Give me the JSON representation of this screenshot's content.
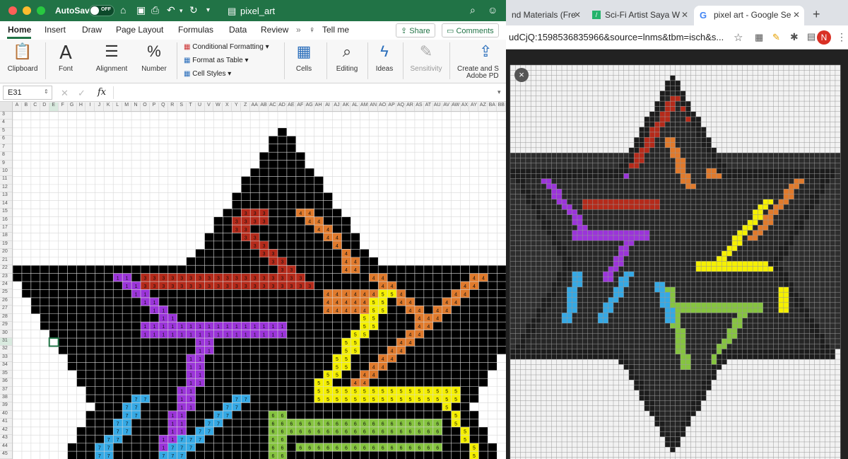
{
  "excel": {
    "window_controls": {
      "close_color": "#ff5f57",
      "min_color": "#febc2e",
      "max_color": "#28c840"
    },
    "autosave_label": "AutoSave",
    "autosave_state": "OFF",
    "doc_title": "pixel_art",
    "ribbon_tabs": [
      "Home",
      "Insert",
      "Draw",
      "Page Layout",
      "Formulas",
      "Data",
      "Review"
    ],
    "overflow": "»",
    "tell_me": "Tell me",
    "share_label": "Share",
    "comments_label": "Comments",
    "groups": {
      "clipboard": "Clipboard",
      "font": "Font",
      "alignment": "Alignment",
      "number": "Number",
      "conditional_formatting": "Conditional Formatting",
      "format_as_table": "Format as Table",
      "cell_styles": "Cell Styles",
      "cells": "Cells",
      "editing": "Editing",
      "ideas": "Ideas",
      "sensitivity": "Sensitivity",
      "create_share": "Create and S",
      "adobe": "Adobe PD"
    },
    "name_box": "E31",
    "fx_label": "fx",
    "columns": [
      "A",
      "B",
      "C",
      "D",
      "E",
      "F",
      "G",
      "H",
      "I",
      "J",
      "K",
      "L",
      "M",
      "N",
      "O",
      "P",
      "Q",
      "R",
      "S",
      "T",
      "U",
      "V",
      "W",
      "X",
      "Y",
      "Z",
      "AA",
      "AB",
      "AC",
      "AD",
      "AE",
      "AF",
      "AG",
      "AH",
      "AI",
      "AJ",
      "AK",
      "AL",
      "AM",
      "AN",
      "AO",
      "AP",
      "AQ",
      "AR",
      "AS",
      "AT",
      "AU",
      "AV",
      "AW",
      "AX",
      "AY",
      "AZ",
      "BA",
      "BB"
    ],
    "first_row": 3,
    "last_row": 45,
    "selected_cell": "E31",
    "colors": {
      "accent": "#217346",
      "black": "#000000",
      "color_1": "#9b34d9",
      "color_3": "#b52a1a",
      "color_4": "#e07a2c",
      "color_5": "#f5f000",
      "color_6": "#86c440",
      "color_7": "#35a9e5"
    }
  },
  "chrome": {
    "tabs": [
      {
        "title": "nd Materials (Fre",
        "icon": "page-icon"
      },
      {
        "title": "Sci-Fi Artist Saya W",
        "icon": "sci-fi-icon"
      },
      {
        "title": "pixel art - Google Se",
        "icon": "google-icon",
        "active": true
      }
    ],
    "new_tab": "+",
    "url": "udCjQ:1598536835966&source=lnms&tbm=isch&s...",
    "profile_initial": "N",
    "close_label": "×"
  }
}
